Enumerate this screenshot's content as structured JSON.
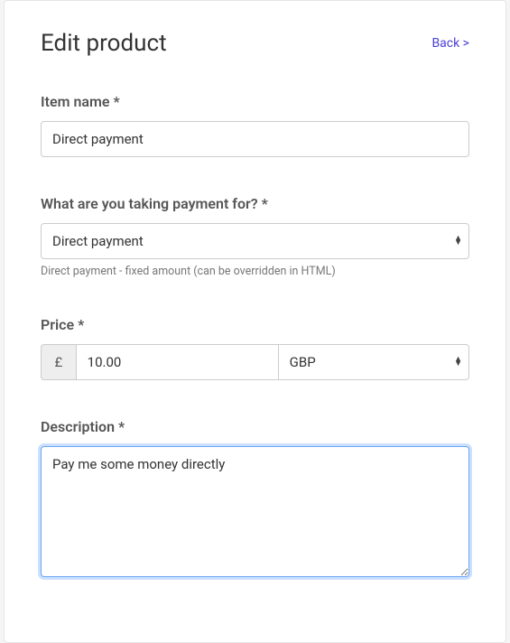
{
  "header": {
    "title": "Edit product",
    "back_label": "Back >"
  },
  "form": {
    "item_name": {
      "label": "Item name *",
      "value": "Direct payment"
    },
    "payment_for": {
      "label": "What are you taking payment for? *",
      "selected": "Direct payment",
      "help": "Direct payment - fixed amount (can be overridden in HTML)"
    },
    "price": {
      "label": "Price *",
      "currency_symbol": "£",
      "amount": "10.00",
      "currency_code": "GBP"
    },
    "description": {
      "label": "Description *",
      "value": "Pay me some money directly"
    }
  }
}
